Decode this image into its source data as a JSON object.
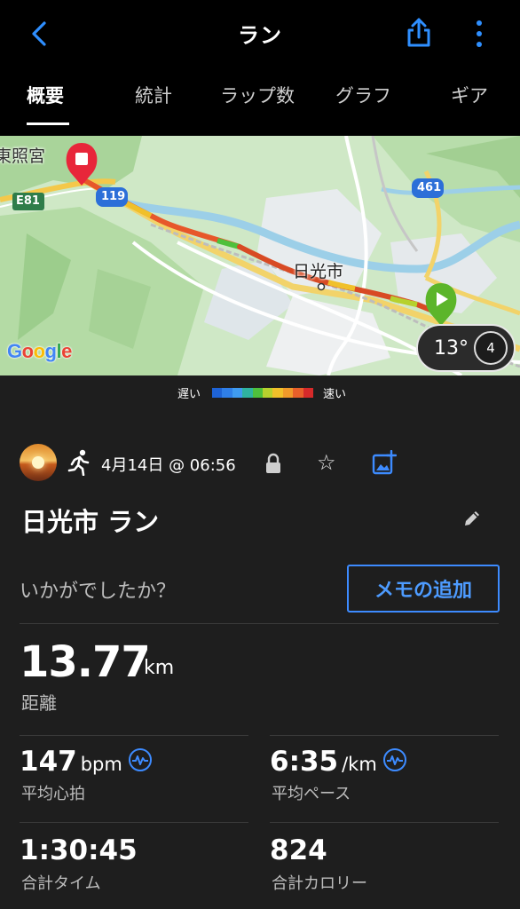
{
  "header": {
    "title": "ラン",
    "back_icon": "chevron-left-icon",
    "share_icon": "share-icon",
    "more_icon": "more-vertical-icon",
    "accent_color": "#2f8fff"
  },
  "tabs": [
    {
      "label": "概要",
      "active": true
    },
    {
      "label": "統計",
      "active": false
    },
    {
      "label": "ラップ数",
      "active": false
    },
    {
      "label": "グラフ",
      "active": false
    },
    {
      "label": "ギア",
      "active": false
    }
  ],
  "map": {
    "labels": {
      "place_tosho": "東照宮",
      "place_nikko": "日光市",
      "road_e81": "E81",
      "road_119": "119",
      "road_461": "461"
    },
    "temperature": "13°",
    "wind": "4",
    "attribution": "Google"
  },
  "pace_legend": {
    "slow": "遅い",
    "fast": "速い",
    "colors": [
      "#1e63d6",
      "#2f7fe8",
      "#3f9bf0",
      "#2fb3a0",
      "#4ec03c",
      "#b6d12e",
      "#f0c02a",
      "#f09a2a",
      "#e8602a",
      "#d62a2a"
    ]
  },
  "activity": {
    "date": "4月14日 @ 06:56",
    "name": "日光市 ラン",
    "prompt": "いかがでしたか？",
    "memo_button": "メモの追加"
  },
  "stats": {
    "distance": {
      "value": "13.77",
      "unit": "km",
      "label": "距離"
    },
    "heart_rate": {
      "value": "147",
      "unit": "bpm",
      "label": "平均心拍"
    },
    "pace": {
      "value": "6:35",
      "unit": "/km",
      "label": "平均ペース"
    },
    "time": {
      "value": "1:30:45",
      "label": "合計タイム"
    },
    "calories": {
      "value": "824",
      "label": "合計カロリー"
    }
  }
}
